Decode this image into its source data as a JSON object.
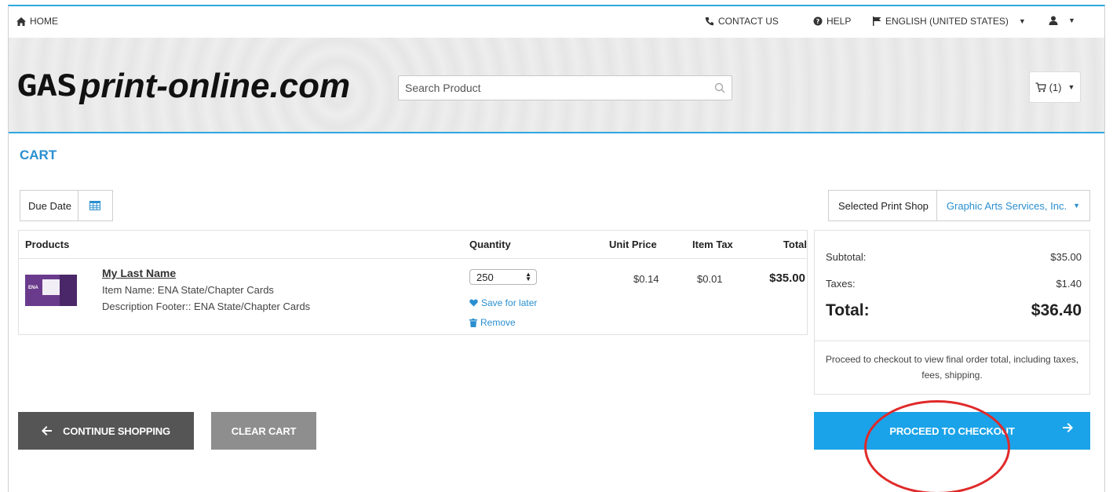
{
  "topbar": {
    "home": "HOME",
    "contact": "CONTACT US",
    "help": "HELP",
    "language": "ENGLISH (UNITED STATES)"
  },
  "header": {
    "logo_mark": "GAS",
    "logo_text": "print-online.com",
    "search_placeholder": "Search Product",
    "cart_count": "(1)"
  },
  "cart": {
    "title": "CART",
    "due_date_label": "Due Date",
    "print_shop_label": "Selected Print Shop",
    "print_shop_value": "Graphic Arts Services, Inc."
  },
  "table": {
    "headers": {
      "products": "Products",
      "quantity": "Quantity",
      "unit_price": "Unit Price",
      "item_tax": "Item Tax",
      "total": "Total"
    },
    "items": [
      {
        "thumb_label": "ENA",
        "name": "My Last Name",
        "item_name": "Item Name: ENA State/Chapter Cards",
        "description": "Description Footer:: ENA State/Chapter Cards",
        "quantity": "250",
        "save_label": "Save for later",
        "remove_label": "Remove",
        "unit_price": "$0.14",
        "item_tax": "$0.01",
        "total": "$35.00"
      }
    ]
  },
  "summary": {
    "subtotal_label": "Subtotal:",
    "subtotal_value": "$35.00",
    "taxes_label": "Taxes:",
    "taxes_value": "$1.40",
    "total_label": "Total:",
    "total_value": "$36.40",
    "note": "Proceed to checkout to view final order total, including taxes, fees, shipping."
  },
  "actions": {
    "continue": "CONTINUE SHOPPING",
    "clear": "CLEAR CART",
    "checkout": "PROCEED TO CHECKOUT"
  },
  "colors": {
    "accent": "#1aa3e8",
    "link": "#2a8fd0",
    "annotation": "#e02a2a"
  }
}
